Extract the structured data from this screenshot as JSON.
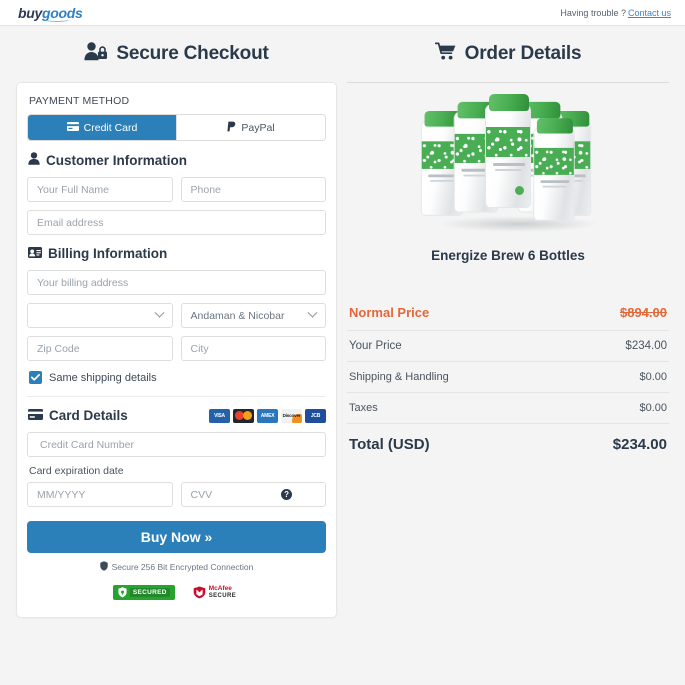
{
  "topbar": {
    "logo_buy": "buy",
    "logo_goods": "goods",
    "help_text": "Having trouble ?",
    "contact_link": "Contact us"
  },
  "checkout": {
    "title": "Secure Checkout",
    "payment_method_label": "PAYMENT METHOD",
    "tabs": [
      {
        "label": "Credit Card",
        "active": true
      },
      {
        "label": "PayPal",
        "active": false
      }
    ],
    "customer_information": {
      "heading": "Customer Information",
      "full_name_placeholder": "Your Full Name",
      "phone_placeholder": "Phone",
      "email_placeholder": "Email address"
    },
    "billing_information": {
      "heading": "Billing Information",
      "address_placeholder": "Your billing address",
      "country_value": "",
      "state_value": "Andaman & Nicobar",
      "zip_placeholder": "Zip Code",
      "city_placeholder": "City",
      "same_shipping_label": "Same shipping details",
      "same_shipping_checked": true
    },
    "card_details": {
      "heading": "Card Details",
      "brands": [
        "VISA",
        "Mastercard",
        "AMEX",
        "Discover",
        "JCB"
      ],
      "card_number_placeholder": "Credit Card Number",
      "expiration_label": "Card expiration date",
      "expiration_placeholder": "MM/YYYY",
      "cvv_placeholder": "CVV"
    },
    "buy_button": "Buy Now »",
    "secure_note": "Secure 256 Bit Encrypted Connection",
    "trust_badges": {
      "secured_label": "SECURED",
      "mcafee_line1": "McAfee",
      "mcafee_line2": "SECURE"
    }
  },
  "order": {
    "title": "Order Details",
    "product_name": "Energize Brew 6 Bottles",
    "lines": [
      {
        "label": "Normal Price",
        "amount": "$894.00"
      },
      {
        "label": "Your Price",
        "amount": "$234.00"
      },
      {
        "label": "Shipping & Handling",
        "amount": "$0.00"
      },
      {
        "label": "Taxes",
        "amount": "$0.00"
      },
      {
        "label": "Total (USD)",
        "amount": "$234.00"
      }
    ]
  },
  "colors": {
    "accent_blue": "#2b80b9",
    "normal_price_orange": "#e2683a",
    "link_blue": "#3a86c8"
  }
}
